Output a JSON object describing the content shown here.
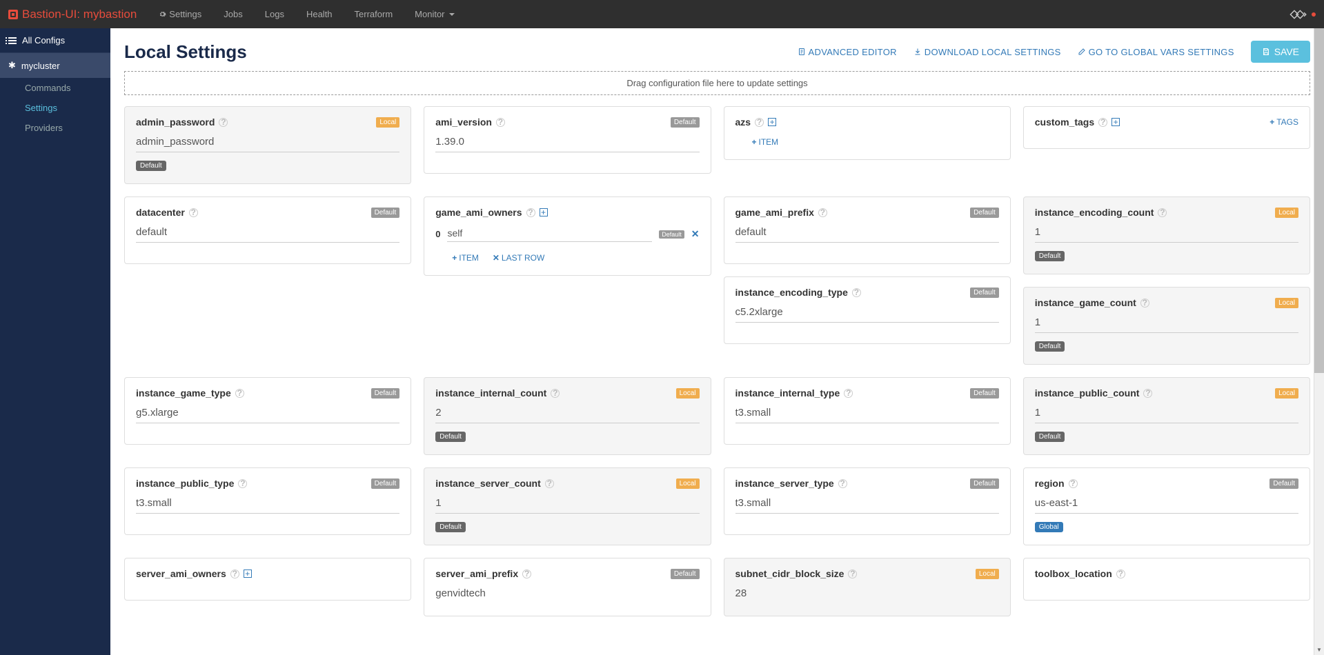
{
  "brand": "Bastion-UI: mybastion",
  "nav": {
    "settings": "Settings",
    "jobs": "Jobs",
    "logs": "Logs",
    "health": "Health",
    "terraform": "Terraform",
    "monitor": "Monitor"
  },
  "sidebar": {
    "all_configs": "All Configs",
    "cluster": "mycluster",
    "items": {
      "commands": "Commands",
      "settings": "Settings",
      "providers": "Providers"
    }
  },
  "page": {
    "title": "Local Settings",
    "advanced": "ADVANCED EDITOR",
    "download": "DOWNLOAD LOCAL SETTINGS",
    "global": "GO TO GLOBAL VARS SETTINGS",
    "save": "SAVE",
    "drag": "Drag configuration file here to update settings"
  },
  "labels": {
    "local": "Local",
    "default": "Default",
    "global": "Global",
    "item": "ITEM",
    "last_row": "LAST ROW",
    "tags": "TAGS"
  },
  "cards": {
    "admin_password": {
      "title": "admin_password",
      "value": "admin_password"
    },
    "ami_version": {
      "title": "ami_version",
      "value": "1.39.0"
    },
    "azs": {
      "title": "azs"
    },
    "custom_tags": {
      "title": "custom_tags"
    },
    "datacenter": {
      "title": "datacenter",
      "value": "default"
    },
    "game_ami_owners": {
      "title": "game_ami_owners",
      "items": [
        {
          "idx": "0",
          "value": "self"
        }
      ]
    },
    "game_ami_prefix": {
      "title": "game_ami_prefix",
      "value": "default"
    },
    "instance_encoding_count": {
      "title": "instance_encoding_count",
      "value": "1"
    },
    "instance_encoding_type": {
      "title": "instance_encoding_type",
      "value": "c5.2xlarge"
    },
    "instance_game_count": {
      "title": "instance_game_count",
      "value": "1"
    },
    "instance_game_type": {
      "title": "instance_game_type",
      "value": "g5.xlarge"
    },
    "instance_internal_count": {
      "title": "instance_internal_count",
      "value": "2"
    },
    "instance_internal_type": {
      "title": "instance_internal_type",
      "value": "t3.small"
    },
    "instance_public_count": {
      "title": "instance_public_count",
      "value": "1"
    },
    "instance_public_type": {
      "title": "instance_public_type",
      "value": "t3.small"
    },
    "instance_server_count": {
      "title": "instance_server_count",
      "value": "1"
    },
    "instance_server_type": {
      "title": "instance_server_type",
      "value": "t3.small"
    },
    "region": {
      "title": "region",
      "value": "us-east-1"
    },
    "server_ami_owners": {
      "title": "server_ami_owners"
    },
    "server_ami_prefix": {
      "title": "server_ami_prefix",
      "value": "genvidtech"
    },
    "subnet_cidr_block_size": {
      "title": "subnet_cidr_block_size",
      "value": "28"
    },
    "toolbox_location": {
      "title": "toolbox_location"
    }
  }
}
